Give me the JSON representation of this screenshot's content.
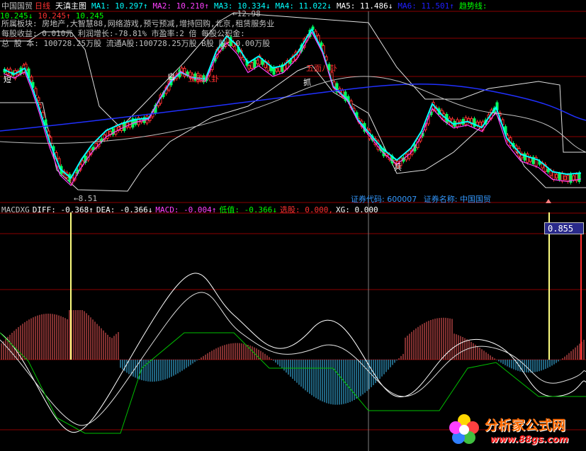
{
  "header": {
    "stock_name": "中国国贸",
    "period": "日线",
    "chart_name": "天滇主图",
    "indicators": [
      {
        "label": "MA1: 10.297↑",
        "color": "#00ffff"
      },
      {
        "label": "MA2: 10.210↑",
        "color": "#ff40ff"
      },
      {
        "label": "MA3: 10.334↓",
        "color": "#00ffff"
      },
      {
        "label": "MA4: 11.022↓",
        "color": "#00ffff"
      },
      {
        "label": "MA5: 11.486↓",
        "color": "#ffffff"
      },
      {
        "label": "MA6: 11.501↑",
        "color": "#2020ff"
      },
      {
        "label": "趋势线: 10.245↓",
        "color": "#00ff00"
      },
      {
        "label": "10.245↑",
        "color": "#ff3030"
      },
      {
        "label": "10.245",
        "color": "#00ff00"
      }
    ]
  },
  "info_panel": {
    "sector": "所属板块: 房地产,大智慧88,网络游戏,预亏预减,增持回购,北京,租赁服务业",
    "eps": "每股收益: 0.010元    利润增长:-78.81%   市盈率:2      倍   每股公积金:",
    "shares": "总 股 本: 100728.25万股  流通A股:100728.25万股 B股 股: 0.00万股"
  },
  "price_annotations": {
    "high": "12.98",
    "low": "8.51"
  },
  "chart_labels": [
    {
      "text": "五面八卦",
      "color": "#ff3030"
    },
    {
      "text": "五面八卦",
      "color": "#ff3030"
    },
    {
      "text": "短",
      "color": "#ffffff"
    },
    {
      "text": "启",
      "color": "#ffffff"
    },
    {
      "text": "抓",
      "color": "#ffffff"
    },
    {
      "text": "兵",
      "color": "#ffffff"
    }
  ],
  "security_line": {
    "code_label": "证券代码:",
    "code": "600007",
    "name_label": "证券名称:",
    "name": "中国国贸",
    "color": "#3399ff"
  },
  "macd_header": [
    {
      "label": "MACDXG",
      "color": "#c0c0c0"
    },
    {
      "label": "DIFF: -0.368↑",
      "color": "#ffffff"
    },
    {
      "label": "DEA: -0.366↓",
      "color": "#ffffff"
    },
    {
      "label": "MACD: -0.004↑",
      "color": "#ff40ff"
    },
    {
      "label": "低值: -0.366↓",
      "color": "#00ff00"
    },
    {
      "label": "选股: 0.000,",
      "color": "#ff3030"
    },
    {
      "label": "XG: 0.000",
      "color": "#ffffff"
    }
  ],
  "value_box": "0.855",
  "watermark": {
    "title": "分析家公式网",
    "url": "www.88gs.com"
  },
  "colors": {
    "grid_red": "#a00000",
    "macd_up": "#ff6060",
    "macd_down": "#40c8ff",
    "background": "#000000"
  }
}
